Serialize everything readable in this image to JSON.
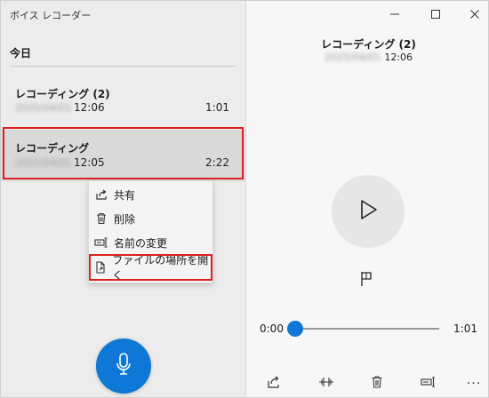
{
  "app": {
    "title": "ボイス レコーダー"
  },
  "list": {
    "section_title": "今日",
    "recordings": [
      {
        "name": "レコーディング (2)",
        "date": "2025/04/01",
        "time": "12:06",
        "duration": "1:01"
      },
      {
        "name": "レコーディング",
        "date": "2025/04/01",
        "time": "12:05",
        "duration": "2:22"
      }
    ]
  },
  "context_menu": {
    "items": [
      {
        "label": "共有",
        "icon": "share-icon"
      },
      {
        "label": "削除",
        "icon": "trash-icon"
      },
      {
        "label": "名前の変更",
        "icon": "rename-icon"
      },
      {
        "label": "ファイルの場所を開く",
        "icon": "file-location-icon"
      }
    ]
  },
  "player": {
    "title": "レコーディング (2)",
    "date": "2025/04/01",
    "time": "12:06",
    "position": "0:00",
    "length": "1:01",
    "progress": 0
  },
  "colors": {
    "accent": "#0f78d7",
    "highlight": "#e02020"
  }
}
